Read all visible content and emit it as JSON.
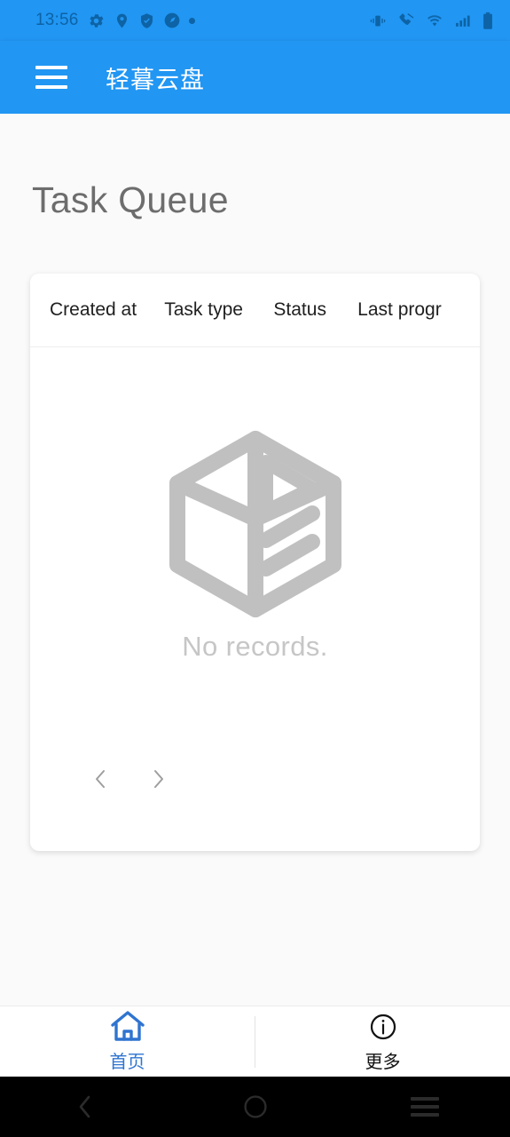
{
  "status_bar": {
    "time": "13:56",
    "left_icons": [
      "gear-icon",
      "location-pin-icon",
      "shield-check-icon",
      "speedometer-icon",
      "dot-icon"
    ],
    "right_icons": [
      "vibrate-icon",
      "call-muted-icon",
      "wifi-icon",
      "signal-bars-icon",
      "battery-icon"
    ],
    "color": "#2196f3",
    "icon_color": "#0d63a5"
  },
  "app_bar": {
    "menu_icon": "hamburger-menu-icon",
    "title": "轻暮云盘",
    "background": "#2196f3",
    "text_color": "#ffffff"
  },
  "page": {
    "title": "Task Queue",
    "title_color": "#6d6d6d",
    "background": "#fafafa"
  },
  "table": {
    "columns": [
      "Created at",
      "Task type",
      "Status",
      "Last progr"
    ],
    "rows": [],
    "empty_state": {
      "icon": "empty-box-icon",
      "text": "No records.",
      "text_color": "#c6c6c6"
    },
    "pagination": {
      "prev_icon": "chevron-left-icon",
      "next_icon": "chevron-right-icon",
      "arrow_color": "#9e9e9e"
    },
    "card_background": "#ffffff"
  },
  "tabbar": {
    "items": [
      {
        "label": "首页",
        "icon": "home-icon",
        "active": true,
        "color": "#2f74d0"
      },
      {
        "label": "更多",
        "icon": "info-circle-icon",
        "active": false,
        "color": "#111111"
      }
    ]
  },
  "system_nav": {
    "back_icon": "chevron-back-icon",
    "home_icon": "circle-home-icon",
    "recents_icon": "recents-lines-icon",
    "background": "#000000"
  }
}
